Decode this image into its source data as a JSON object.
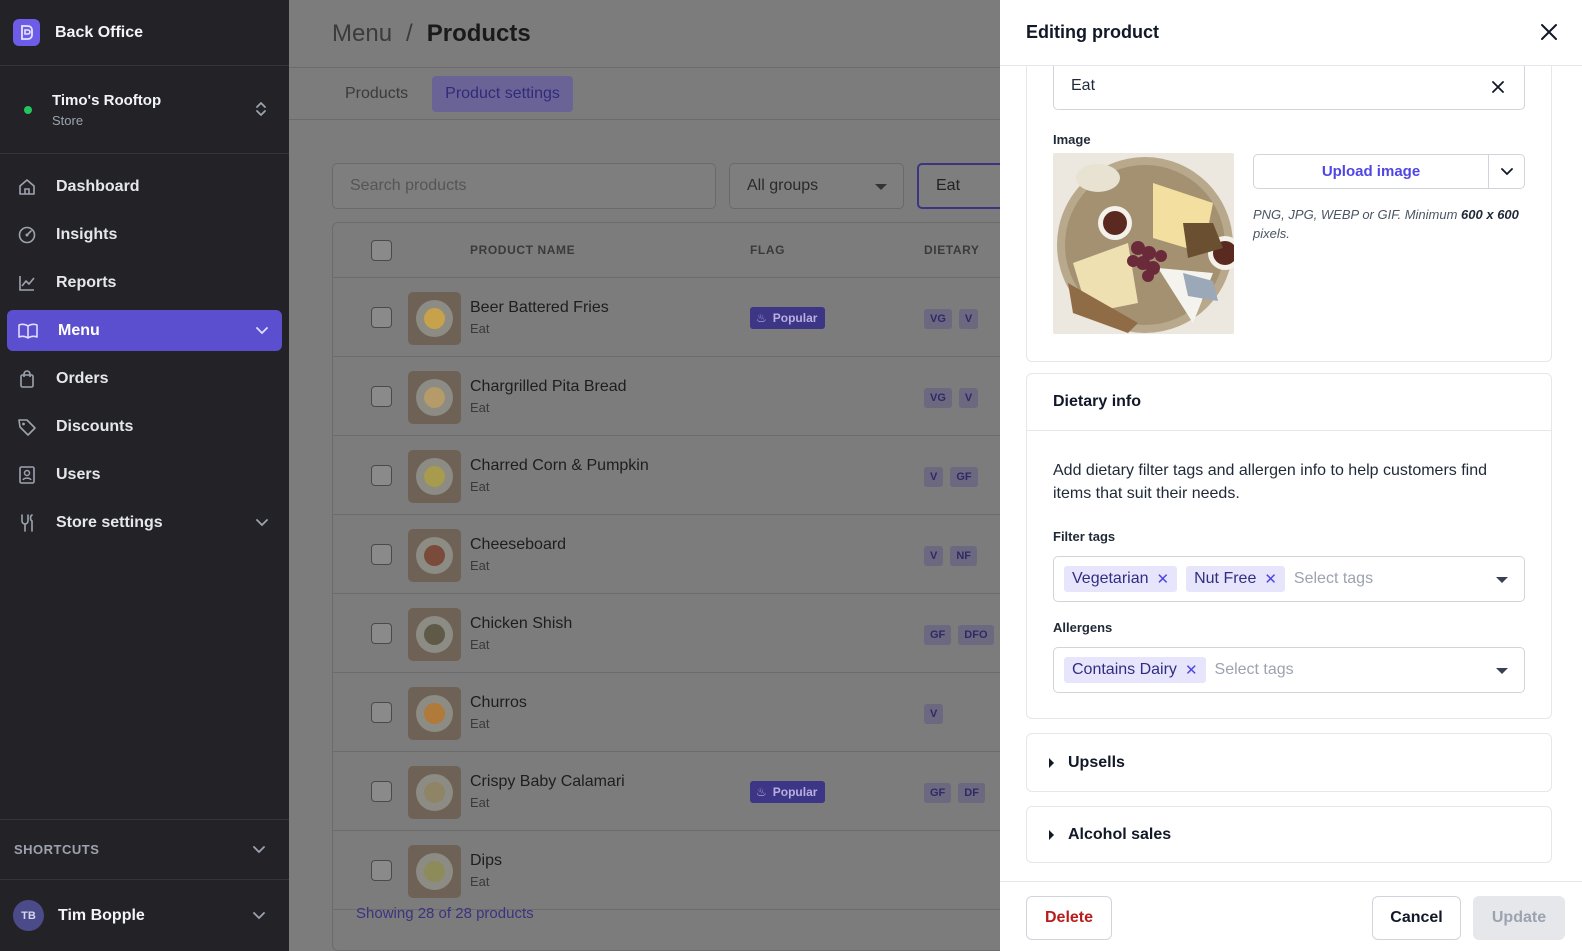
{
  "app": {
    "title": "Back Office"
  },
  "store": {
    "name": "Timo's Rooftop",
    "type": "Store"
  },
  "nav": [
    {
      "label": "Dashboard",
      "icon": "home-icon"
    },
    {
      "label": "Insights",
      "icon": "insights-icon"
    },
    {
      "label": "Reports",
      "icon": "chart-line-icon"
    },
    {
      "label": "Menu",
      "icon": "book-icon",
      "active": true
    },
    {
      "label": "Orders",
      "icon": "bag-icon"
    },
    {
      "label": "Discounts",
      "icon": "tag-icon"
    },
    {
      "label": "Users",
      "icon": "user-badge-icon"
    },
    {
      "label": "Store settings",
      "icon": "tools-icon"
    }
  ],
  "shortcuts": {
    "label": "SHORTCUTS"
  },
  "user": {
    "initials": "TB",
    "name": "Tim Bopple"
  },
  "breadcrumb": {
    "parent": "Menu",
    "separator": "/",
    "current": "Products"
  },
  "tabs": [
    {
      "label": "Products"
    },
    {
      "label": "Product settings",
      "active": true
    }
  ],
  "filters": {
    "search_placeholder": "Search products",
    "group": "All groups",
    "category": "Eat"
  },
  "table": {
    "headers": {
      "name": "PRODUCT NAME",
      "flag": "FLAG",
      "dietary": "DIETARY"
    },
    "rows": [
      {
        "name": "Beer Battered Fries",
        "category": "Eat",
        "flag": "Popular",
        "tags": [
          "VG",
          "V"
        ]
      },
      {
        "name": "Chargrilled Pita Bread",
        "category": "Eat",
        "flag": "",
        "tags": [
          "VG",
          "V"
        ]
      },
      {
        "name": "Charred Corn & Pumpkin",
        "category": "Eat",
        "flag": "",
        "tags": [
          "V",
          "GF"
        ]
      },
      {
        "name": "Cheeseboard",
        "category": "Eat",
        "flag": "",
        "tags": [
          "V",
          "NF"
        ]
      },
      {
        "name": "Chicken Shish",
        "category": "Eat",
        "flag": "",
        "tags": [
          "GF",
          "DFO"
        ]
      },
      {
        "name": "Churros",
        "category": "Eat",
        "flag": "",
        "tags": [
          "V"
        ]
      },
      {
        "name": "Crispy Baby Calamari",
        "category": "Eat",
        "flag": "Popular",
        "tags": [
          "GF",
          "DF"
        ]
      },
      {
        "name": "Dips",
        "category": "Eat",
        "flag": "",
        "tags": []
      }
    ],
    "footer": "Showing 28 of 28 products"
  },
  "drawer": {
    "title": "Editing product",
    "category_value": "Eat",
    "image": {
      "label": "Image",
      "upload_label": "Upload image",
      "hint_prefix": "PNG, JPG, WEBP or GIF. Minimum ",
      "hint_bold": "600 x 600",
      "hint_suffix": " pixels."
    },
    "dietary": {
      "title": "Dietary info",
      "description": "Add dietary filter tags and allergen info to help customers find items that suit their needs.",
      "filter_label": "Filter tags",
      "filter_tags": [
        "Vegetarian",
        "Nut Free"
      ],
      "allergens_label": "Allergens",
      "allergens": [
        "Contains Dairy"
      ],
      "placeholder": "Select tags"
    },
    "upsells": "Upsells",
    "alcohol": "Alcohol sales",
    "buttons": {
      "delete": "Delete",
      "cancel": "Cancel",
      "update": "Update"
    }
  }
}
